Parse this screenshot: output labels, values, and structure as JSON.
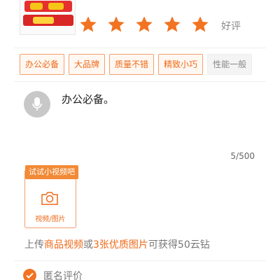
{
  "product": {
    "image_icon": "glue-stick-product-image"
  },
  "rating": {
    "stars": 5,
    "max_stars": 5,
    "star_color": "#f27322",
    "label": "好评"
  },
  "tags": [
    {
      "label": "办公必备",
      "selected": true
    },
    {
      "label": "大品牌",
      "selected": true
    },
    {
      "label": "质量不错",
      "selected": true
    },
    {
      "label": "精致小巧",
      "selected": true
    },
    {
      "label": "性能一般",
      "selected": false
    }
  ],
  "review": {
    "avatar_icon": "microphone-icon",
    "text": "办公必备。",
    "char_count": "5/500"
  },
  "upload": {
    "badge": "试试小视频吧",
    "label": "视频/图片",
    "icon": "camera-icon"
  },
  "reward": {
    "part1": "上传",
    "highlight1": "商品视频",
    "part2": "或",
    "highlight2": "3张优质图片",
    "part3": "可获得50云钻"
  },
  "anonymous": {
    "checked": true,
    "label": "匿名评价"
  },
  "colors": {
    "accent": "#f27322",
    "tag_border": "#f0a070",
    "muted_text": "#777777"
  }
}
